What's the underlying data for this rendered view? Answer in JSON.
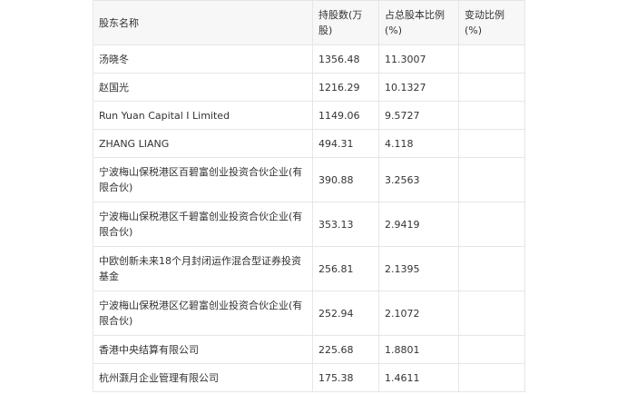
{
  "table": {
    "headers": [
      "股东名称",
      "持股数(万股)",
      "占总股本比例(%)",
      "变动比例(%)"
    ],
    "rows": [
      {
        "name": "汤晓冬",
        "shares": "1356.48",
        "ratio": "11.3007",
        "change": ""
      },
      {
        "name": "赵国光",
        "shares": "1216.29",
        "ratio": "10.1327",
        "change": ""
      },
      {
        "name": "Run Yuan Capital I Limited",
        "shares": "1149.06",
        "ratio": "9.5727",
        "change": ""
      },
      {
        "name": "ZHANG LIANG",
        "shares": "494.31",
        "ratio": "4.118",
        "change": ""
      },
      {
        "name": "宁波梅山保税港区百碧富创业投资合伙企业(有限合伙)",
        "shares": "390.88",
        "ratio": "3.2563",
        "change": ""
      },
      {
        "name": "宁波梅山保税港区千碧富创业投资合伙企业(有限合伙)",
        "shares": "353.13",
        "ratio": "2.9419",
        "change": ""
      },
      {
        "name": "中欧创新未来18个月封闭运作混合型证券投资基金",
        "shares": "256.81",
        "ratio": "2.1395",
        "change": ""
      },
      {
        "name": "宁波梅山保税港区亿碧富创业投资合伙企业(有限合伙)",
        "shares": "252.94",
        "ratio": "2.1072",
        "change": ""
      },
      {
        "name": "香港中央结算有限公司",
        "shares": "225.68",
        "ratio": "1.8801",
        "change": ""
      },
      {
        "name": "杭州灏月企业管理有限公司",
        "shares": "175.38",
        "ratio": "1.4611",
        "change": ""
      }
    ]
  }
}
